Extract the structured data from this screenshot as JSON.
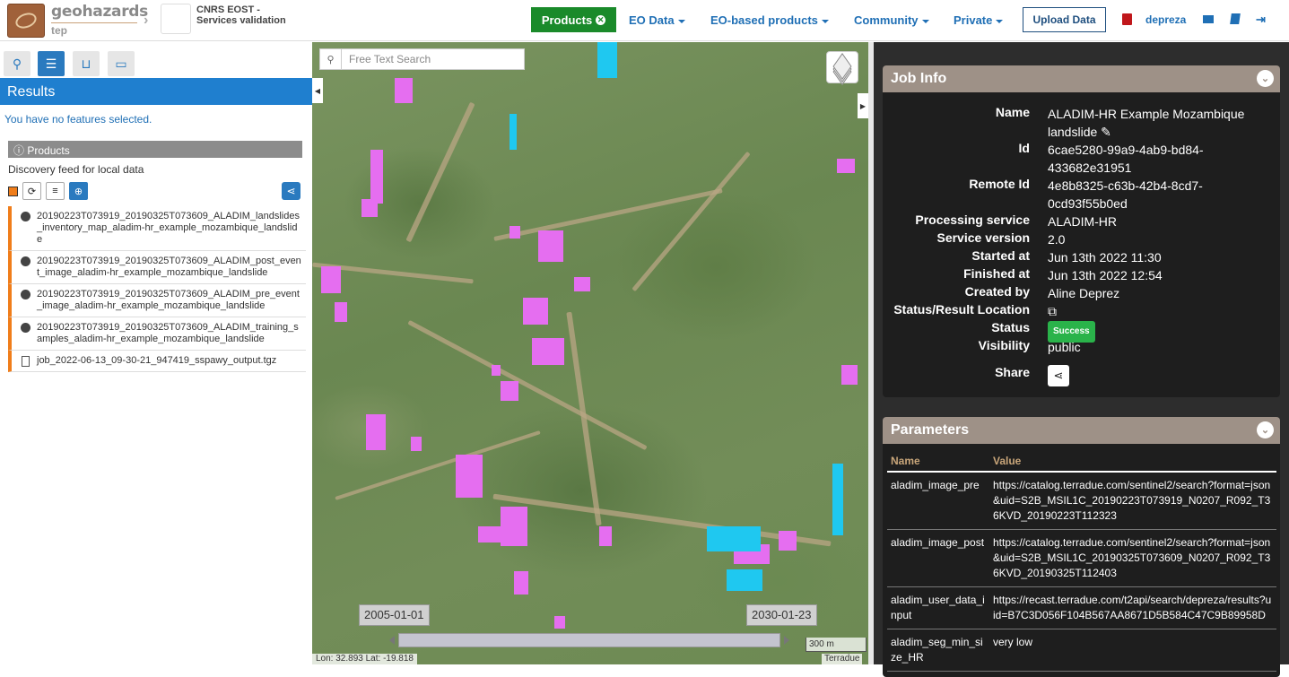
{
  "brand": {
    "name": "geohazards",
    "sub": "tep"
  },
  "community": {
    "name": "CNRS EOST - Services validation"
  },
  "nav": {
    "products": "Products",
    "eo_data": "EO Data",
    "eo_products": "EO-based products",
    "community": "Community",
    "private": "Private",
    "upload": "Upload Data",
    "user": "depreza"
  },
  "left": {
    "results_title": "Results",
    "no_features": "You have no features selected.",
    "products_header": "Products",
    "discovery": "Discovery feed for local data",
    "items": [
      "20190223T073919_20190325T073609_ALADIM_landslides_inventory_map_aladim-hr_example_mozambique_landslide",
      "20190223T073919_20190325T073609_ALADIM_post_event_image_aladim-hr_example_mozambique_landslide",
      "20190223T073919_20190325T073609_ALADIM_pre_event_image_aladim-hr_example_mozambique_landslide",
      "20190223T073919_20190325T073609_ALADIM_training_samples_aladim-hr_example_mozambique_landslide",
      "job_2022-06-13_09-30-21_947419_sspawy_output.tgz"
    ]
  },
  "map": {
    "search_placeholder": "Free Text Search",
    "date_start": "2005-01-01",
    "date_end": "2030-01-23",
    "scale": "300 m",
    "coords": "Lon: 32.893 Lat: -19.818",
    "attribution": "Terradue"
  },
  "job": {
    "title": "Job Info",
    "name_label": "Name",
    "name": "ALADIM-HR Example Mozambique landslide",
    "id_label": "Id",
    "id": "6cae5280-99a9-4ab9-bd84-433682e31951",
    "remote_label": "Remote Id",
    "remote": "4e8b8325-c63b-42b4-8cd7-0cd93f55b0ed",
    "service_label": "Processing service",
    "service": "ALADIM-HR",
    "version_label": "Service version",
    "version": "2.0",
    "started_label": "Started at",
    "started": "Jun 13th 2022 11:30",
    "finished_label": "Finished at",
    "finished": "Jun 13th 2022 12:54",
    "created_label": "Created by",
    "created": "Aline Deprez",
    "location_label": "Status/Result Location",
    "status_label": "Status",
    "status": "Success",
    "visibility_label": "Visibility",
    "visibility": "public",
    "share_label": "Share"
  },
  "params": {
    "title": "Parameters",
    "col_name": "Name",
    "col_value": "Value",
    "rows": [
      {
        "name": "aladim_image_pre",
        "value": "https://catalog.terradue.com/sentinel2/search?format=json&uid=S2B_MSIL1C_20190223T073919_N0207_R092_T36KVD_20190223T112323"
      },
      {
        "name": "aladim_image_post",
        "value": "https://catalog.terradue.com/sentinel2/search?format=json&uid=S2B_MSIL1C_20190325T073609_N0207_R092_T36KVD_20190325T112403"
      },
      {
        "name": "aladim_user_data_input",
        "value": "https://recast.terradue.com/t2api/search/depreza/results?uid=B7C3D056F104B567AA8671D5B584C47C9B89958D"
      },
      {
        "name": "aladim_seg_min_size_HR",
        "value": "very low"
      }
    ]
  },
  "colors": {
    "accent": "#1f7fcf",
    "products_btn": "#1a8a2a",
    "feed": "#f07d1a",
    "landslide": "#e56ef0",
    "water": "#1fc8f0",
    "panel_head": "#9e9187"
  }
}
